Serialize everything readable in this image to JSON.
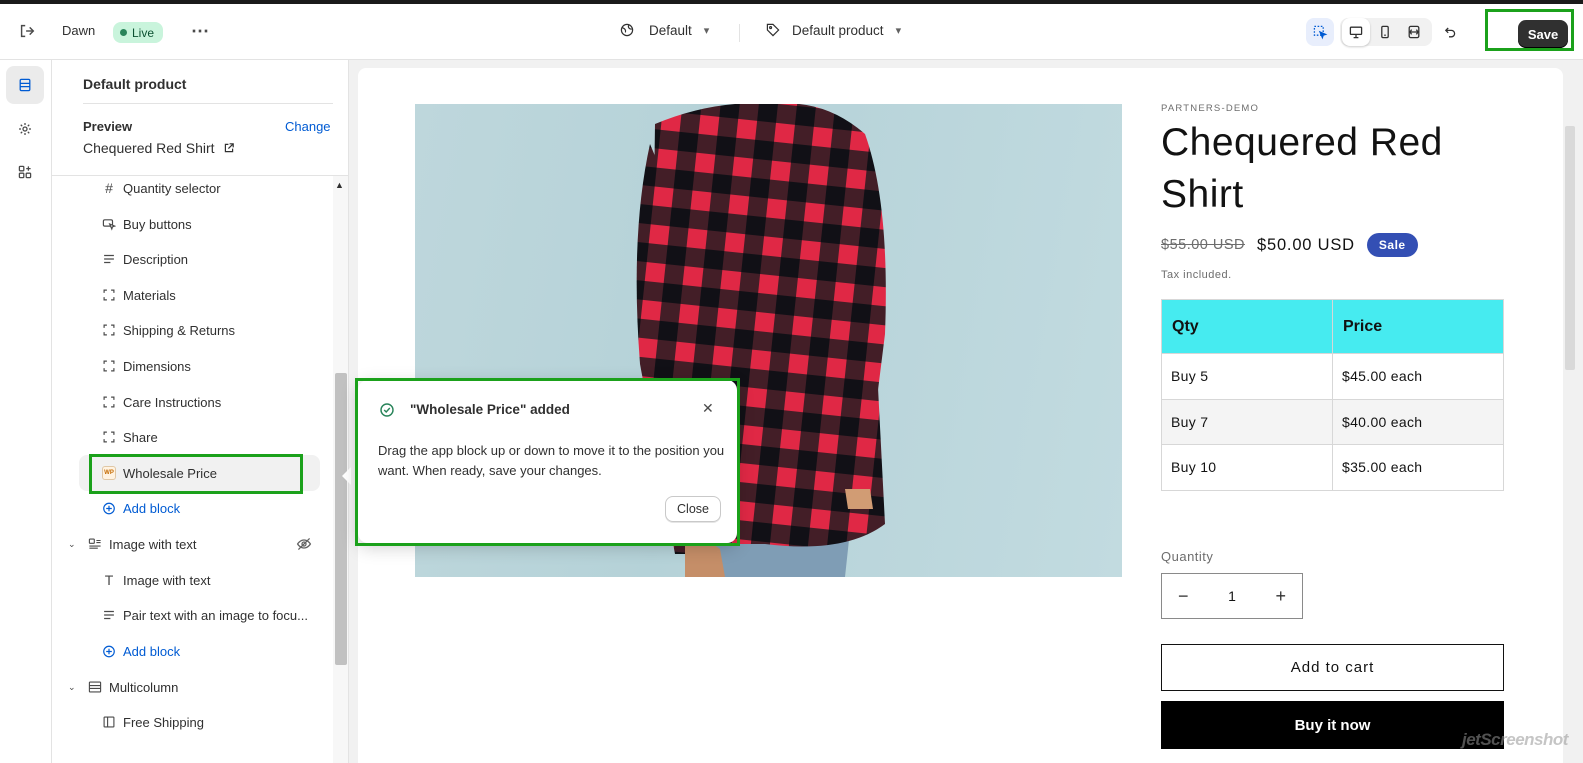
{
  "topbar": {
    "theme_name": "Dawn",
    "live_label": "Live",
    "template_dropdown": "Default",
    "product_dropdown": "Default product",
    "save_label": "Save"
  },
  "sidebar": {
    "title": "Default product",
    "preview_label": "Preview",
    "change_label": "Change",
    "preview_value": "Chequered Red Shirt",
    "items": [
      {
        "label": "Quantity selector",
        "icon": "hash-icon"
      },
      {
        "label": "Buy buttons",
        "icon": "cursor-icon"
      },
      {
        "label": "Description",
        "icon": "text-lines-icon"
      },
      {
        "label": "Materials",
        "icon": "collapsible-icon"
      },
      {
        "label": "Shipping & Returns",
        "icon": "collapsible-icon"
      },
      {
        "label": "Dimensions",
        "icon": "collapsible-icon"
      },
      {
        "label": "Care Instructions",
        "icon": "collapsible-icon"
      },
      {
        "label": "Share",
        "icon": "collapsible-icon"
      },
      {
        "label": "Wholesale Price",
        "icon": "app-logo-icon"
      },
      {
        "label": "Add block",
        "icon": "plus-circle-icon"
      }
    ],
    "section_image_text": "Image with text",
    "image_text_items": [
      {
        "label": "Image with text",
        "icon": "text-t-icon"
      },
      {
        "label": "Pair text with an image to focu...",
        "icon": "text-lines-icon"
      },
      {
        "label": "Add block",
        "icon": "plus-circle-icon"
      }
    ],
    "section_multicolumn": "Multicolumn",
    "multicolumn_items": [
      {
        "label": "Free Shipping",
        "icon": "column-icon"
      }
    ]
  },
  "toast": {
    "title": "\"Wholesale Price\" added",
    "body": "Drag the app block up or down to move it to the position you want. When ready, save your changes.",
    "close_label": "Close"
  },
  "product": {
    "vendor": "PARTNERS-DEMO",
    "title": "Chequered Red Shirt",
    "old_price": "$55.00 USD",
    "new_price": "$50.00 USD",
    "sale_badge": "Sale",
    "tax_note": "Tax included.",
    "wholesale_table": {
      "headers": [
        "Qty",
        "Price"
      ],
      "rows": [
        [
          "Buy 5",
          "$45.00 each"
        ],
        [
          "Buy 7",
          "$40.00 each"
        ],
        [
          "Buy 10",
          "$35.00 each"
        ]
      ]
    },
    "quantity_label": "Quantity",
    "quantity_value": "1",
    "add_to_cart": "Add to cart",
    "buy_now": "Buy it now"
  },
  "watermark": "jetScreenshot",
  "colors": {
    "accent_blue": "#005bd3",
    "live_green": "#c9f4dc",
    "table_header": "#46ebf0",
    "sale_badge": "#334fb4",
    "highlight_green": "#1ba11b"
  }
}
